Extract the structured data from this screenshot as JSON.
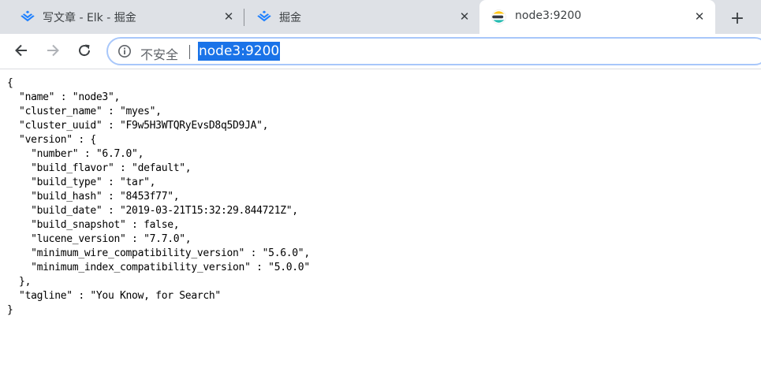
{
  "browser": {
    "tabs": [
      {
        "title": "写文章 - Elk - 掘金",
        "favicon": "juejin-icon",
        "active": false
      },
      {
        "title": "掘金",
        "favicon": "juejin-icon",
        "active": false
      },
      {
        "title": "node3:9200",
        "favicon": "elasticsearch-icon",
        "active": true
      }
    ],
    "new_tab_label": "+",
    "close_label": "✕",
    "toolbar": {
      "back_icon": "back-arrow-icon",
      "forward_icon": "forward-arrow-icon",
      "reload_icon": "reload-icon",
      "security_icon": "info-icon",
      "security_text": "不安全",
      "url": "node3:9200"
    }
  },
  "page": {
    "json_text": "{\n  \"name\" : \"node3\",\n  \"cluster_name\" : \"myes\",\n  \"cluster_uuid\" : \"F9w5H3WTQRyEvsD8q5D9JA\",\n  \"version\" : {\n    \"number\" : \"6.7.0\",\n    \"build_flavor\" : \"default\",\n    \"build_type\" : \"tar\",\n    \"build_hash\" : \"8453f77\",\n    \"build_date\" : \"2019-03-21T15:32:29.844721Z\",\n    \"build_snapshot\" : false,\n    \"lucene_version\" : \"7.7.0\",\n    \"minimum_wire_compatibility_version\" : \"5.6.0\",\n    \"minimum_index_compatibility_version\" : \"5.0.0\"\n  },\n  \"tagline\" : \"You Know, for Search\"\n}"
  },
  "colors": {
    "tabstrip_bg": "#dee1e6",
    "url_highlight": "#1a73e8",
    "omnibox_border": "#a8c7fa",
    "elastic_yellow": "#fec514",
    "elastic_teal": "#24bbb1",
    "juejin_blue": "#1e80ff"
  }
}
